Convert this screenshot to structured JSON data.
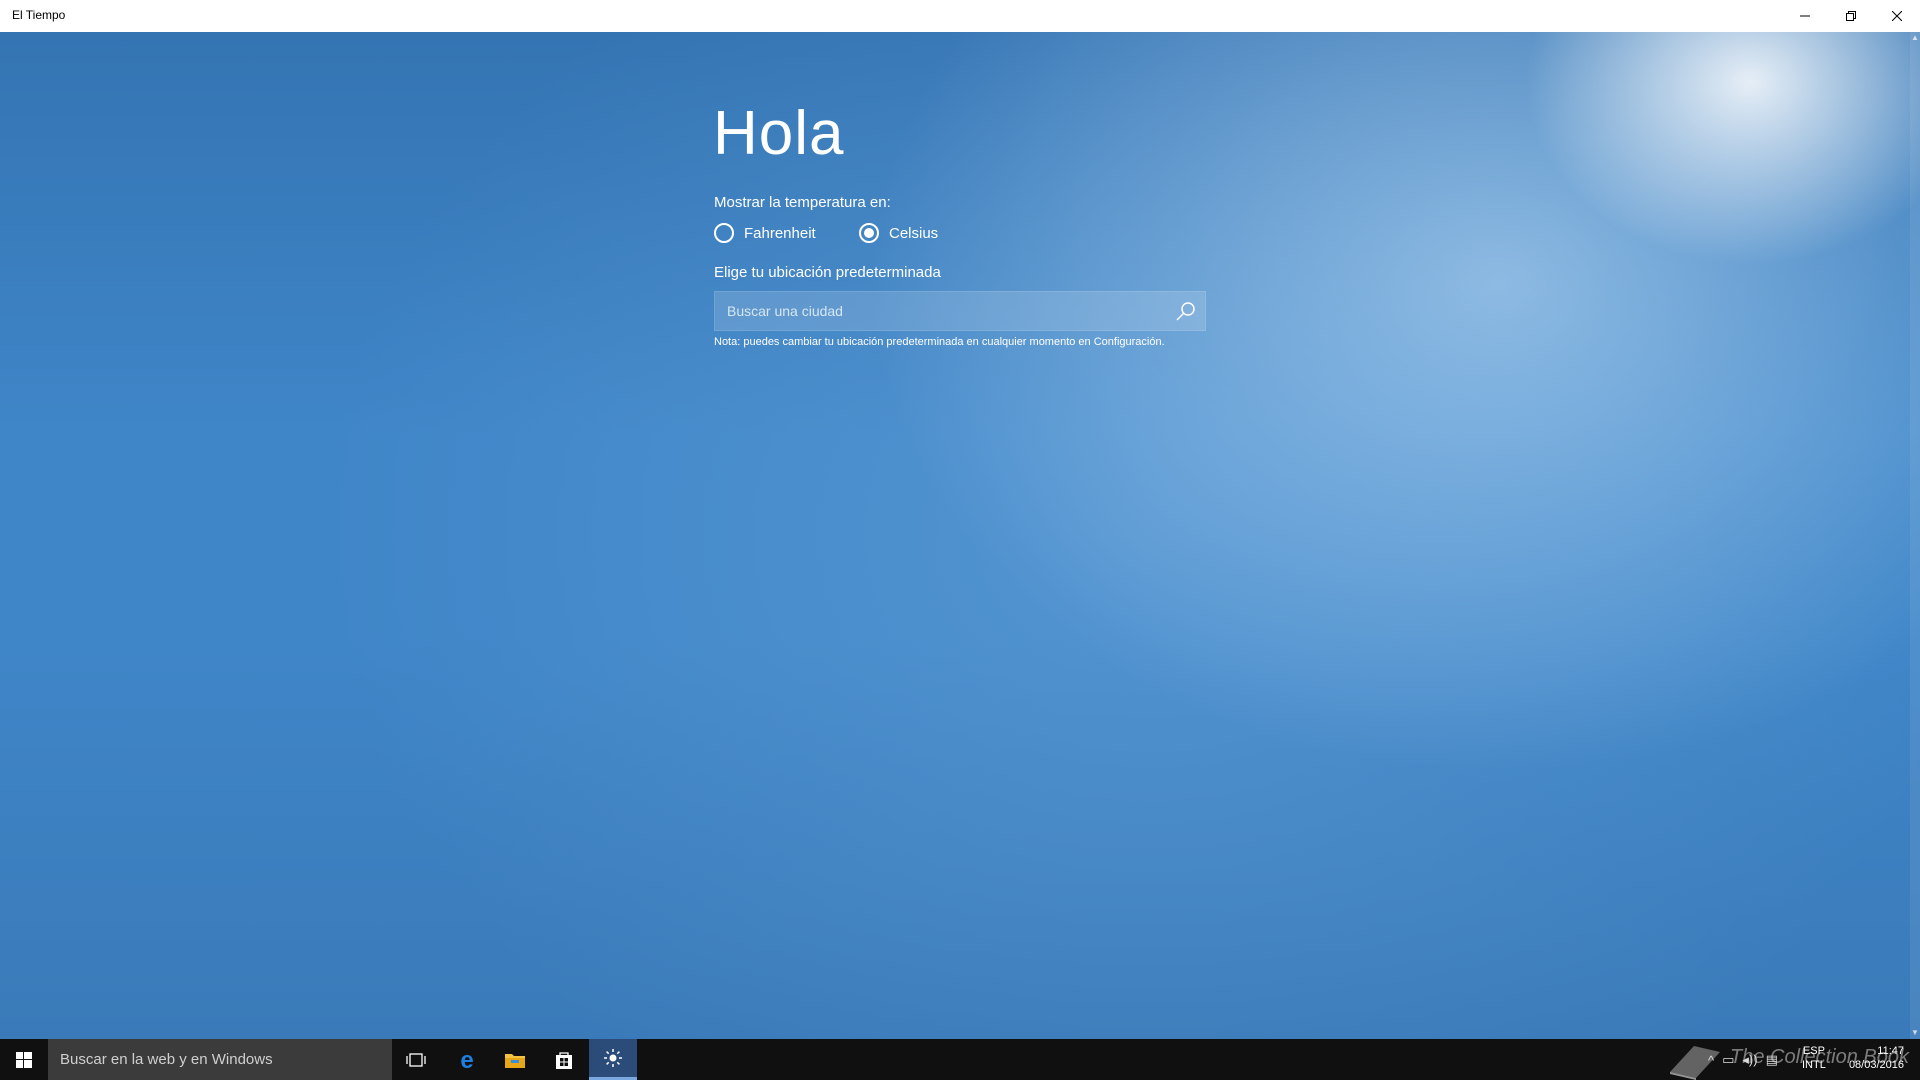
{
  "window": {
    "title": "El Tiempo",
    "controls": {
      "minimize": "minimize",
      "restore": "restore",
      "close": "close"
    }
  },
  "setup": {
    "greeting": "Hola",
    "temperature_label": "Mostrar la temperatura en:",
    "units": [
      {
        "label": "Fahrenheit",
        "selected": false
      },
      {
        "label": "Celsius",
        "selected": true
      }
    ],
    "location_label": "Elige tu ubicación predeterminada",
    "search_placeholder": "Buscar una ciudad",
    "search_value": "",
    "note": "Nota: puedes cambiar tu ubicación predeterminada en cualquier momento en Configuración."
  },
  "taskbar": {
    "search_placeholder": "Buscar en la web y en Windows",
    "pinned_icons": [
      "task-view-icon",
      "edge-icon",
      "file-explorer-icon",
      "store-icon",
      "weather-icon"
    ],
    "active_app": "weather-icon",
    "watermark": "The Collection Book",
    "lang_top": "ESP",
    "lang_bottom": "INTL",
    "time": "11:47",
    "date": "08/03/2016"
  },
  "colors": {
    "accent": "#3f86c8",
    "taskbar": "#101010",
    "taskbar_search": "#3b3b3b"
  }
}
